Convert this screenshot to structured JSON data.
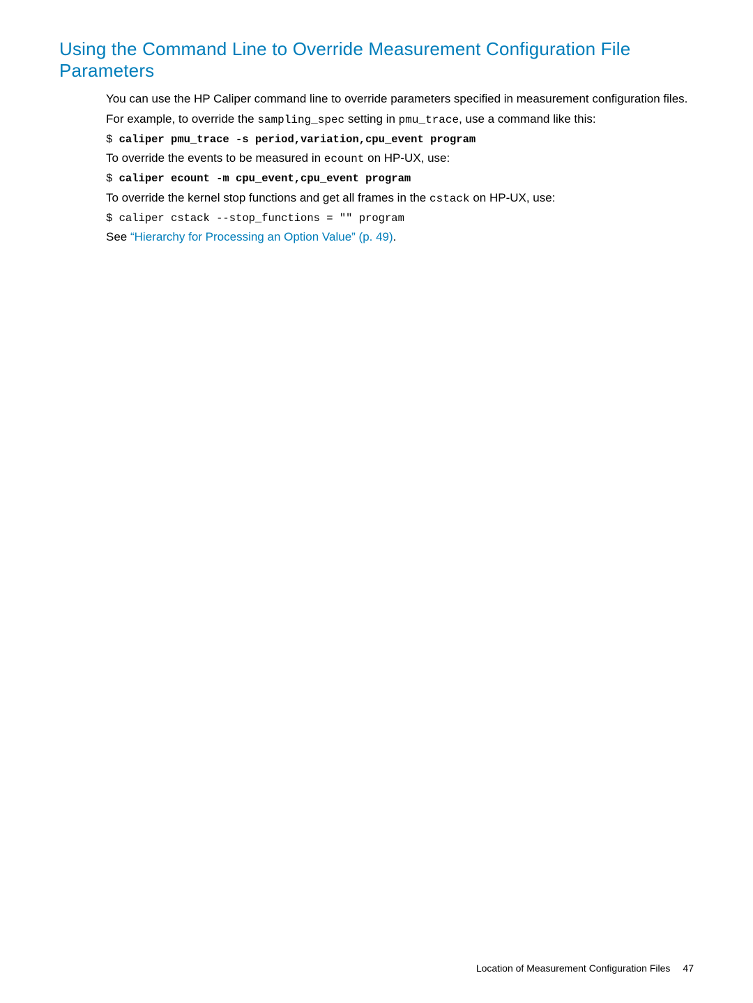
{
  "heading": "Using the Command Line to Override Measurement Configuration File Parameters",
  "p1_a": "You can use the HP Caliper command line to override parameters specified in measurement configuration files.",
  "p2_a": "For example, to override the ",
  "p2_code1": "sampling_spec",
  "p2_b": " setting in ",
  "p2_code2": "pmu_trace",
  "p2_c": ", use a command like this:",
  "cmd1_prefix": "$ ",
  "cmd1_body": "caliper pmu_trace -s period,variation,cpu_event program",
  "p3_a": "To override the events to be measured in ",
  "p3_code": "ecount",
  "p3_b": " on HP-UX, use:",
  "cmd2_prefix": "$ ",
  "cmd2_body": "caliper ecount -m cpu_event,cpu_event program",
  "p4_a": "To override the kernel stop functions and get all frames in the ",
  "p4_code": "cstack",
  "p4_b": " on HP-UX, use:",
  "cmd3": " $ caliper cstack --stop_functions = \"\" program",
  "p5_a": "See ",
  "p5_link": "“Hierarchy for Processing an Option Value” (p. 49)",
  "p5_b": ".",
  "footer_text": "Location of Measurement Configuration Files",
  "footer_page": "47"
}
